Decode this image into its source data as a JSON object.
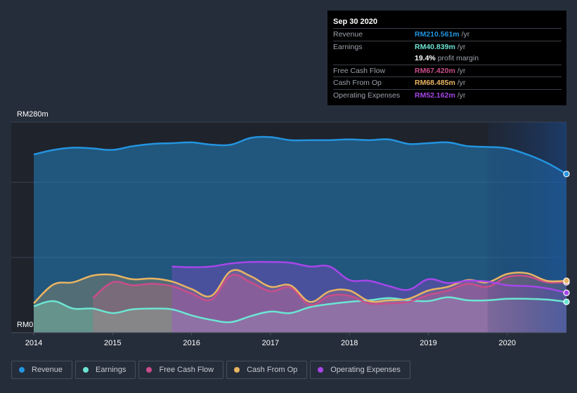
{
  "tooltip": {
    "date": "Sep 30 2020",
    "rows": [
      {
        "label": "Revenue",
        "value": "RM210.561m",
        "unit": " /yr",
        "color": "#2394df"
      },
      {
        "label": "Earnings",
        "value": "RM40.839m",
        "unit": " /yr",
        "color": "#6ce5d2"
      },
      {
        "label": "",
        "value": "19.4%",
        "unit": " profit margin",
        "color": "#ffffff"
      },
      {
        "label": "Free Cash Flow",
        "value": "RM67.420m",
        "unit": " /yr",
        "color": "#c94d8b"
      },
      {
        "label": "Cash From Op",
        "value": "RM68.485m",
        "unit": " /yr",
        "color": "#e9b463"
      },
      {
        "label": "Operating Expenses",
        "value": "RM52.162m",
        "unit": " /yr",
        "color": "#a646e8"
      }
    ]
  },
  "legend": [
    {
      "label": "Revenue",
      "color": "#2394df"
    },
    {
      "label": "Earnings",
      "color": "#6ce5d2"
    },
    {
      "label": "Free Cash Flow",
      "color": "#c94d8b"
    },
    {
      "label": "Cash From Op",
      "color": "#e9b463"
    },
    {
      "label": "Operating Expenses",
      "color": "#a646e8"
    }
  ],
  "chart_data": {
    "type": "area",
    "title": "",
    "xlabel": "",
    "ylabel": "",
    "y_unit": "RM m",
    "ylim": [
      0,
      280
    ],
    "xlim": [
      2014,
      2020.75
    ],
    "y_tick_labels": [
      {
        "value": 280,
        "label": "RM280m"
      },
      {
        "value": 0,
        "label": "RM0"
      }
    ],
    "y_gridlines": [
      0,
      100,
      200,
      280
    ],
    "x_ticks": [
      2014,
      2015,
      2016,
      2017,
      2018,
      2019,
      2020
    ],
    "x_tick_labels": [
      "2014",
      "2015",
      "2016",
      "2017",
      "2018",
      "2019",
      "2020"
    ],
    "highlight_region_start": 2019.75,
    "legend_position": "bottom-left",
    "series": [
      {
        "name": "Revenue",
        "color": "#2394df",
        "x": [
          2014,
          2014.25,
          2014.5,
          2014.75,
          2015,
          2015.25,
          2015.5,
          2015.75,
          2016,
          2016.25,
          2016.5,
          2016.75,
          2017,
          2017.25,
          2017.5,
          2017.75,
          2018,
          2018.25,
          2018.5,
          2018.75,
          2019,
          2019.25,
          2019.5,
          2019.75,
          2020,
          2020.25,
          2020.5,
          2020.75
        ],
        "values": [
          237,
          243,
          246,
          245,
          243,
          248,
          251,
          252,
          253,
          250,
          250,
          259,
          260,
          256,
          256,
          256,
          257,
          256,
          257,
          251,
          252,
          253,
          248,
          247,
          245,
          237,
          226,
          211
        ]
      },
      {
        "name": "Earnings",
        "color": "#6ce5d2",
        "x": [
          2014,
          2014.25,
          2014.5,
          2014.75,
          2015,
          2015.25,
          2015.5,
          2015.75,
          2016,
          2016.25,
          2016.5,
          2016.75,
          2017,
          2017.25,
          2017.5,
          2017.75,
          2018,
          2018.25,
          2018.5,
          2018.75,
          2019,
          2019.25,
          2019.5,
          2019.75,
          2020,
          2020.25,
          2020.5,
          2020.75
        ],
        "values": [
          35,
          42,
          32,
          32,
          26,
          31,
          32,
          31,
          23,
          17,
          14,
          22,
          28,
          26,
          34,
          38,
          41,
          43,
          46,
          43,
          42,
          47,
          43,
          43,
          45,
          45,
          44,
          41
        ]
      },
      {
        "name": "Free Cash Flow",
        "color": "#c94d8b",
        "x": [
          2014.75,
          2015,
          2015.25,
          2015.5,
          2015.75,
          2016,
          2016.25,
          2016.5,
          2016.75,
          2017,
          2017.25,
          2017.5,
          2017.75,
          2018,
          2018.25,
          2018.5,
          2018.75,
          2019,
          2019.25,
          2019.5,
          2019.75,
          2020,
          2020.25,
          2020.5,
          2020.75
        ],
        "values": [
          46,
          67,
          63,
          65,
          62,
          52,
          44,
          76,
          67,
          55,
          60,
          37,
          49,
          49,
          39,
          39,
          41,
          50,
          56,
          65,
          61,
          74,
          75,
          67,
          67
        ]
      },
      {
        "name": "Cash From Op",
        "color": "#e9b463",
        "x": [
          2014,
          2014.25,
          2014.5,
          2014.75,
          2015,
          2015.25,
          2015.5,
          2015.75,
          2016,
          2016.25,
          2016.5,
          2016.75,
          2017,
          2017.25,
          2017.5,
          2017.75,
          2018,
          2018.25,
          2018.5,
          2018.75,
          2019,
          2019.25,
          2019.5,
          2019.75,
          2020,
          2020.25,
          2020.5,
          2020.75
        ],
        "values": [
          39,
          64,
          67,
          76,
          77,
          71,
          72,
          68,
          58,
          49,
          82,
          75,
          61,
          63,
          41,
          55,
          56,
          42,
          43,
          45,
          56,
          61,
          70,
          67,
          78,
          79,
          69,
          69
        ]
      },
      {
        "name": "Operating Expenses",
        "color": "#a646e8",
        "x": [
          2015.75,
          2016,
          2016.25,
          2016.5,
          2016.75,
          2017,
          2017.25,
          2017.5,
          2017.75,
          2018,
          2018.25,
          2018.5,
          2018.75,
          2019,
          2019.25,
          2019.5,
          2019.75,
          2020,
          2020.25,
          2020.5,
          2020.75
        ],
        "values": [
          88,
          87,
          88,
          92,
          94,
          94,
          93,
          88,
          88,
          70,
          69,
          62,
          57,
          71,
          66,
          69,
          68,
          63,
          62,
          59,
          53
        ]
      }
    ]
  }
}
